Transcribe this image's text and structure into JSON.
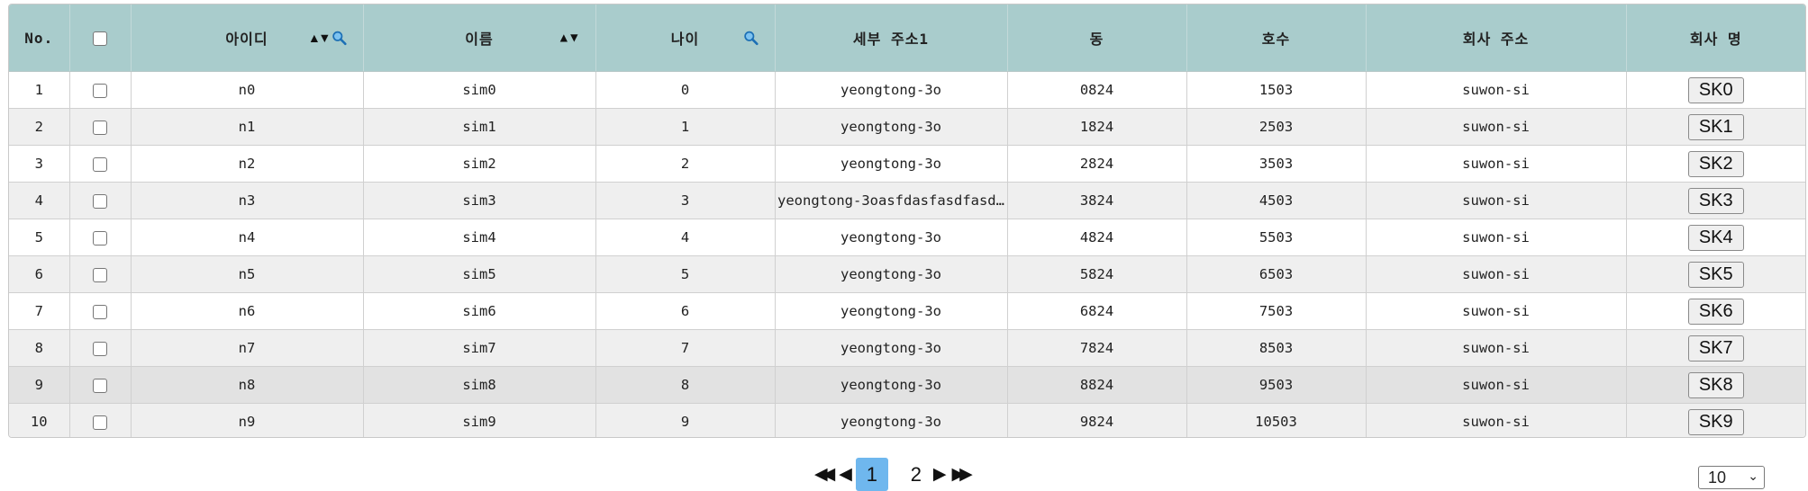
{
  "table": {
    "columns": [
      {
        "key": "no",
        "label": "No."
      },
      {
        "key": "check",
        "label": ""
      },
      {
        "key": "id",
        "label": "아이디",
        "sortable": true,
        "searchable": true
      },
      {
        "key": "name",
        "label": "이름",
        "sortable": true,
        "searchable": false
      },
      {
        "key": "age",
        "label": "나이",
        "sortable": false,
        "searchable": true
      },
      {
        "key": "addr1",
        "label": "세부 주소1"
      },
      {
        "key": "dong",
        "label": "동"
      },
      {
        "key": "ho",
        "label": "호수"
      },
      {
        "key": "company_addr",
        "label": "회사 주소"
      },
      {
        "key": "company_name",
        "label": "회사 명"
      }
    ],
    "sort_up_icon": "▲",
    "sort_down_icon": "▼",
    "rows": [
      {
        "no": "1",
        "id": "n0",
        "name": "sim0",
        "age": "0",
        "addr1": "yeongtong-3o",
        "dong": "0824",
        "ho": "1503",
        "company_addr": "suwon-si",
        "company_name": "SK0"
      },
      {
        "no": "2",
        "id": "n1",
        "name": "sim1",
        "age": "1",
        "addr1": "yeongtong-3o",
        "dong": "1824",
        "ho": "2503",
        "company_addr": "suwon-si",
        "company_name": "SK1"
      },
      {
        "no": "3",
        "id": "n2",
        "name": "sim2",
        "age": "2",
        "addr1": "yeongtong-3o",
        "dong": "2824",
        "ho": "3503",
        "company_addr": "suwon-si",
        "company_name": "SK2"
      },
      {
        "no": "4",
        "id": "n3",
        "name": "sim3",
        "age": "3",
        "addr1": "yeongtong-3oasfdasfasdfasd…",
        "dong": "3824",
        "ho": "4503",
        "company_addr": "suwon-si",
        "company_name": "SK3"
      },
      {
        "no": "5",
        "id": "n4",
        "name": "sim4",
        "age": "4",
        "addr1": "yeongtong-3o",
        "dong": "4824",
        "ho": "5503",
        "company_addr": "suwon-si",
        "company_name": "SK4"
      },
      {
        "no": "6",
        "id": "n5",
        "name": "sim5",
        "age": "5",
        "addr1": "yeongtong-3o",
        "dong": "5824",
        "ho": "6503",
        "company_addr": "suwon-si",
        "company_name": "SK5"
      },
      {
        "no": "7",
        "id": "n6",
        "name": "sim6",
        "age": "6",
        "addr1": "yeongtong-3o",
        "dong": "6824",
        "ho": "7503",
        "company_addr": "suwon-si",
        "company_name": "SK6"
      },
      {
        "no": "8",
        "id": "n7",
        "name": "sim7",
        "age": "7",
        "addr1": "yeongtong-3o",
        "dong": "7824",
        "ho": "8503",
        "company_addr": "suwon-si",
        "company_name": "SK7"
      },
      {
        "no": "9",
        "id": "n8",
        "name": "sim8",
        "age": "8",
        "addr1": "yeongtong-3o",
        "dong": "8824",
        "ho": "9503",
        "company_addr": "suwon-si",
        "company_name": "SK8"
      },
      {
        "no": "10",
        "id": "n9",
        "name": "sim9",
        "age": "9",
        "addr1": "yeongtong-3o",
        "dong": "9824",
        "ho": "10503",
        "company_addr": "suwon-si",
        "company_name": "SK9"
      }
    ]
  },
  "pagination": {
    "first_icon": "◀◀",
    "prev_icon": "◀",
    "next_icon": "▶",
    "last_icon": "▶▶",
    "pages": [
      "1",
      "2"
    ],
    "current": "1"
  },
  "page_size": {
    "selected": "10"
  },
  "colors": {
    "header_bg": "#a9cccc",
    "active_page": "#6fb7ee",
    "row_alt": "#efefef"
  }
}
